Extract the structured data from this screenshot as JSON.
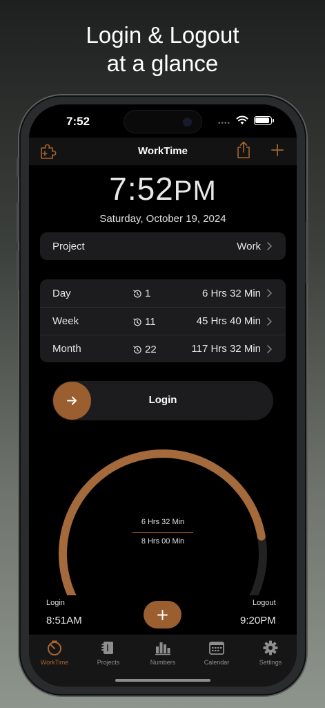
{
  "headline": {
    "line1": "Login & Logout",
    "line2": "at a glance"
  },
  "status_bar": {
    "time": "7:52",
    "dots": "••••"
  },
  "navbar": {
    "title": "WorkTime"
  },
  "clock": {
    "time": "7:52",
    "ampm": "PM",
    "date": "Saturday, October 19, 2024"
  },
  "project": {
    "label": "Project",
    "value": "Work"
  },
  "stats": [
    {
      "label": "Day",
      "count": "1",
      "duration": "6 Hrs 32 Min"
    },
    {
      "label": "Week",
      "count": "11",
      "duration": "45 Hrs 40 Min"
    },
    {
      "label": "Month",
      "count": "22",
      "duration": "117 Hrs 32 Min"
    }
  ],
  "slider": {
    "label": "Login"
  },
  "gauge": {
    "worked": "6 Hrs 32 Min",
    "goal": "8 Hrs 00 Min",
    "progress_fraction": 0.82,
    "progress_color": "#a46a3c",
    "track_color": "#222222"
  },
  "login": {
    "label": "Login",
    "time": "8:51AM"
  },
  "logout": {
    "label": "Logout",
    "time": "9:20PM"
  },
  "tabs": [
    {
      "label": "WorkTime",
      "icon": "timer-icon",
      "active": true
    },
    {
      "label": "Projects",
      "icon": "binder-icon"
    },
    {
      "label": "Numbers",
      "icon": "bar-chart-icon"
    },
    {
      "label": "Calendar",
      "icon": "calendar-icon"
    },
    {
      "label": "Settings",
      "icon": "gear-icon"
    }
  ],
  "colors": {
    "accent": "#a8652f",
    "knob": "#9a5e2f",
    "card": "#1c1c1e"
  }
}
